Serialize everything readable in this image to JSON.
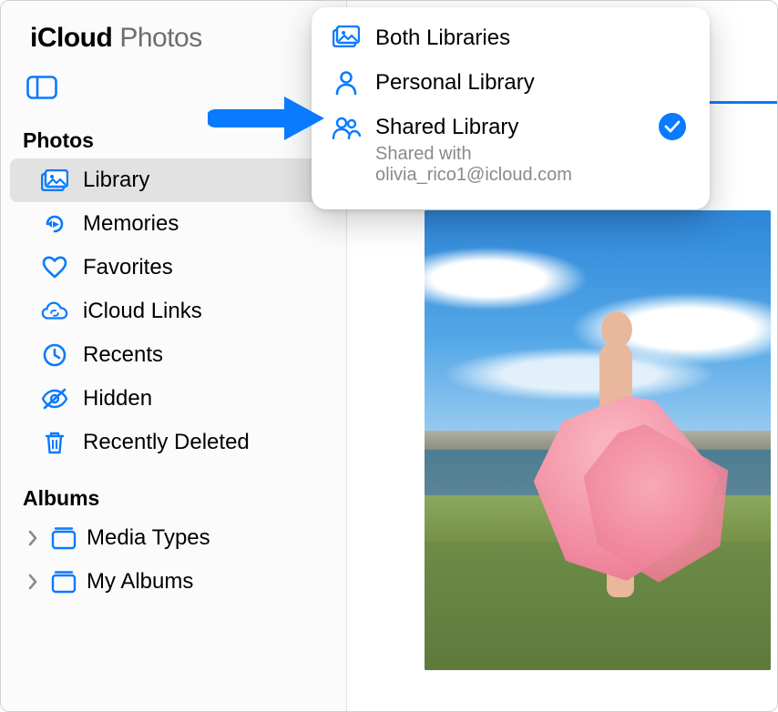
{
  "brand": {
    "icloud": "iCloud",
    "app": "Photos"
  },
  "sections": {
    "photos_title": "Photos",
    "albums_title": "Albums"
  },
  "sidebar": {
    "items": [
      {
        "label": "Library",
        "icon": "photo-stack-icon",
        "selected": true
      },
      {
        "label": "Memories",
        "icon": "memories-icon"
      },
      {
        "label": "Favorites",
        "icon": "heart-icon"
      },
      {
        "label": "iCloud Links",
        "icon": "cloud-link-icon"
      },
      {
        "label": "Recents",
        "icon": "clock-icon"
      },
      {
        "label": "Hidden",
        "icon": "eye-slash-icon"
      },
      {
        "label": "Recently Deleted",
        "icon": "trash-icon"
      }
    ],
    "albums": [
      {
        "label": "Media Types",
        "icon": "album-icon"
      },
      {
        "label": "My Albums",
        "icon": "album-icon"
      }
    ]
  },
  "popover": {
    "items": [
      {
        "label": "Both Libraries",
        "icon": "photo-stack-icon"
      },
      {
        "label": "Personal Library",
        "icon": "person-icon"
      },
      {
        "label": "Shared Library",
        "icon": "people-icon",
        "selected": true,
        "subtitle_line1": "Shared with",
        "subtitle_line2": "olivia_rico1@icloud.com"
      }
    ]
  },
  "colors": {
    "accent": "#0a7aff",
    "sidebar_bg": "#fbfbfb",
    "selected_bg": "#e2e2e2",
    "muted_text": "#8a8a8a"
  }
}
